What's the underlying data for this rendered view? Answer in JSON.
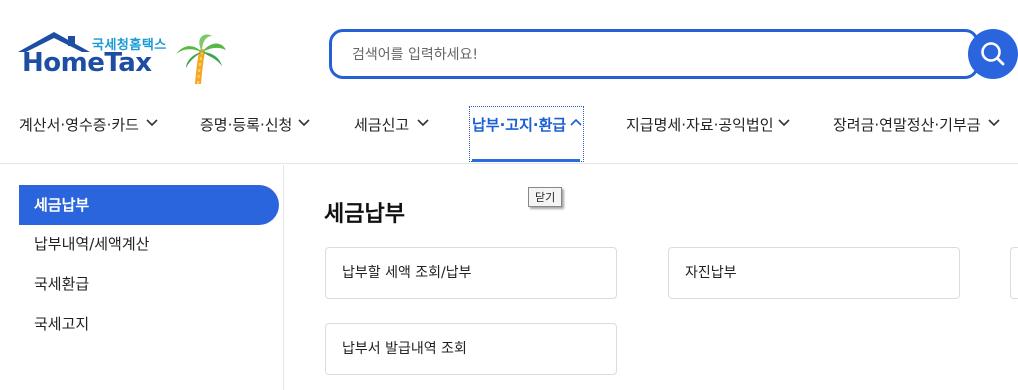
{
  "logo": {
    "korean": "국세청홈택스",
    "english": "HomeTax",
    "accent": "#1d4ea3"
  },
  "search": {
    "placeholder": "검색어를 입력하세요!",
    "value": ""
  },
  "nav": {
    "items": [
      {
        "label": "계산서·영수증·카드"
      },
      {
        "label": "증명·등록·신청"
      },
      {
        "label": "세금신고"
      },
      {
        "label": "납부·고지·환급",
        "active": true
      },
      {
        "label": "지급명세·자료·공익법인"
      },
      {
        "label": "장려금·연말정산·기부금"
      }
    ]
  },
  "tooltip": {
    "text": "닫기"
  },
  "sidebar": {
    "items": [
      {
        "label": "세금납부",
        "active": true
      },
      {
        "label": "납부내역/세액계산"
      },
      {
        "label": "국세환급"
      },
      {
        "label": "국세고지"
      }
    ]
  },
  "content": {
    "title": "세금납부",
    "cards": [
      {
        "label": "납부할 세액 조회/납부"
      },
      {
        "label": "자진납부"
      },
      {
        "label": ""
      },
      {
        "label": "납부서 발급내역 조회"
      }
    ]
  },
  "colors": {
    "primary": "#2a65dd",
    "active_text": "#1a5fd6",
    "border": "#d8dde3"
  },
  "icons": [
    "house-logo-icon",
    "palm-tree-icon",
    "search-icon",
    "chevron-down-icon",
    "chevron-up-icon"
  ]
}
